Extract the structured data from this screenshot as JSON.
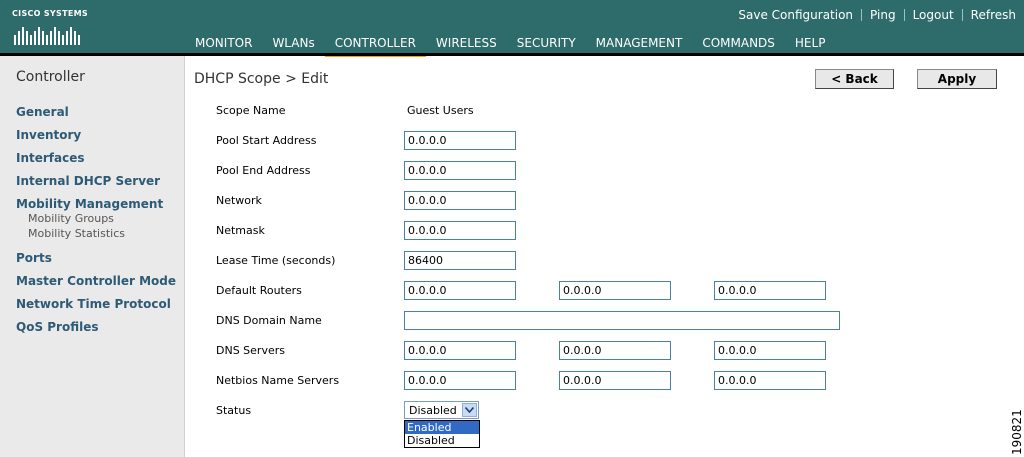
{
  "header": {
    "brand": "CISCO SYSTEMS",
    "links": [
      "Save Configuration",
      "Ping",
      "Logout",
      "Refresh"
    ],
    "nav": [
      "MONITOR",
      "WLANs",
      "CONTROLLER",
      "WIRELESS",
      "SECURITY",
      "MANAGEMENT",
      "COMMANDS",
      "HELP"
    ],
    "active_nav": "CONTROLLER",
    "colors": {
      "bar": "#2e6b6b",
      "active_tab": "#f0a020"
    }
  },
  "sidebar": {
    "title": "Controller",
    "items": [
      "General",
      "Inventory",
      "Interfaces",
      "Internal DHCP Server",
      "Mobility Management",
      "Ports",
      "Master Controller Mode",
      "Network Time Protocol",
      "QoS Profiles"
    ],
    "mobility_sub": [
      "Mobility Groups",
      "Mobility Statistics"
    ]
  },
  "page": {
    "title": "DHCP Scope > Edit",
    "back_label": "< Back",
    "apply_label": "Apply"
  },
  "form": {
    "scope_name_label": "Scope Name",
    "scope_name_value": "Guest Users",
    "pool_start_label": "Pool Start Address",
    "pool_start_value": "0.0.0.0",
    "pool_end_label": "Pool End Address",
    "pool_end_value": "0.0.0.0",
    "network_label": "Network",
    "network_value": "0.0.0.0",
    "netmask_label": "Netmask",
    "netmask_value": "0.0.0.0",
    "lease_label": "Lease Time (seconds)",
    "lease_value": "86400",
    "routers_label": "Default Routers",
    "routers_values": [
      "0.0.0.0",
      "0.0.0.0",
      "0.0.0.0"
    ],
    "dns_domain_label": "DNS Domain Name",
    "dns_domain_value": "",
    "dns_servers_label": "DNS Servers",
    "dns_servers_values": [
      "0.0.0.0",
      "0.0.0.0",
      "0.0.0.0"
    ],
    "netbios_label": "Netbios Name Servers",
    "netbios_values": [
      "0.0.0.0",
      "0.0.0.0",
      "0.0.0.0"
    ],
    "status_label": "Status",
    "status_value": "Disabled",
    "status_options": [
      "Enabled",
      "Disabled"
    ],
    "status_highlighted": "Enabled"
  },
  "figure_id": "190821"
}
